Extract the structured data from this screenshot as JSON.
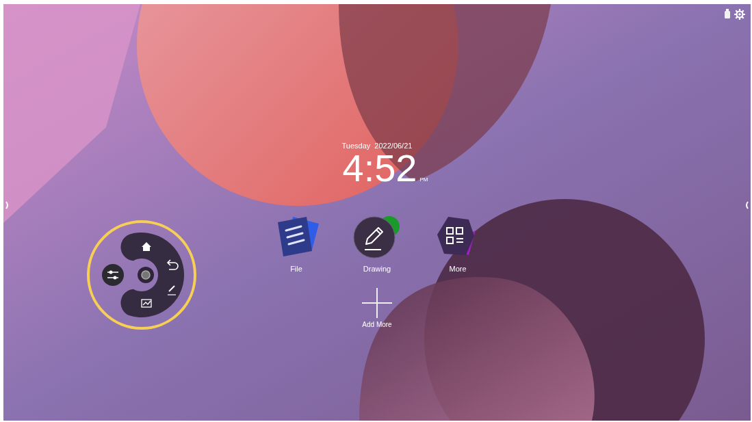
{
  "clock": {
    "weekday": "Tuesday",
    "date": "2022/06/21",
    "time": "4:52",
    "meridiem": "PM"
  },
  "apps": [
    {
      "label": "File",
      "kind": "file"
    },
    {
      "label": "Drawing",
      "kind": "drawing"
    },
    {
      "label": "More",
      "kind": "more"
    }
  ],
  "add_more": {
    "label": "Add More"
  },
  "floating_menu": {
    "highlighted": true
  }
}
